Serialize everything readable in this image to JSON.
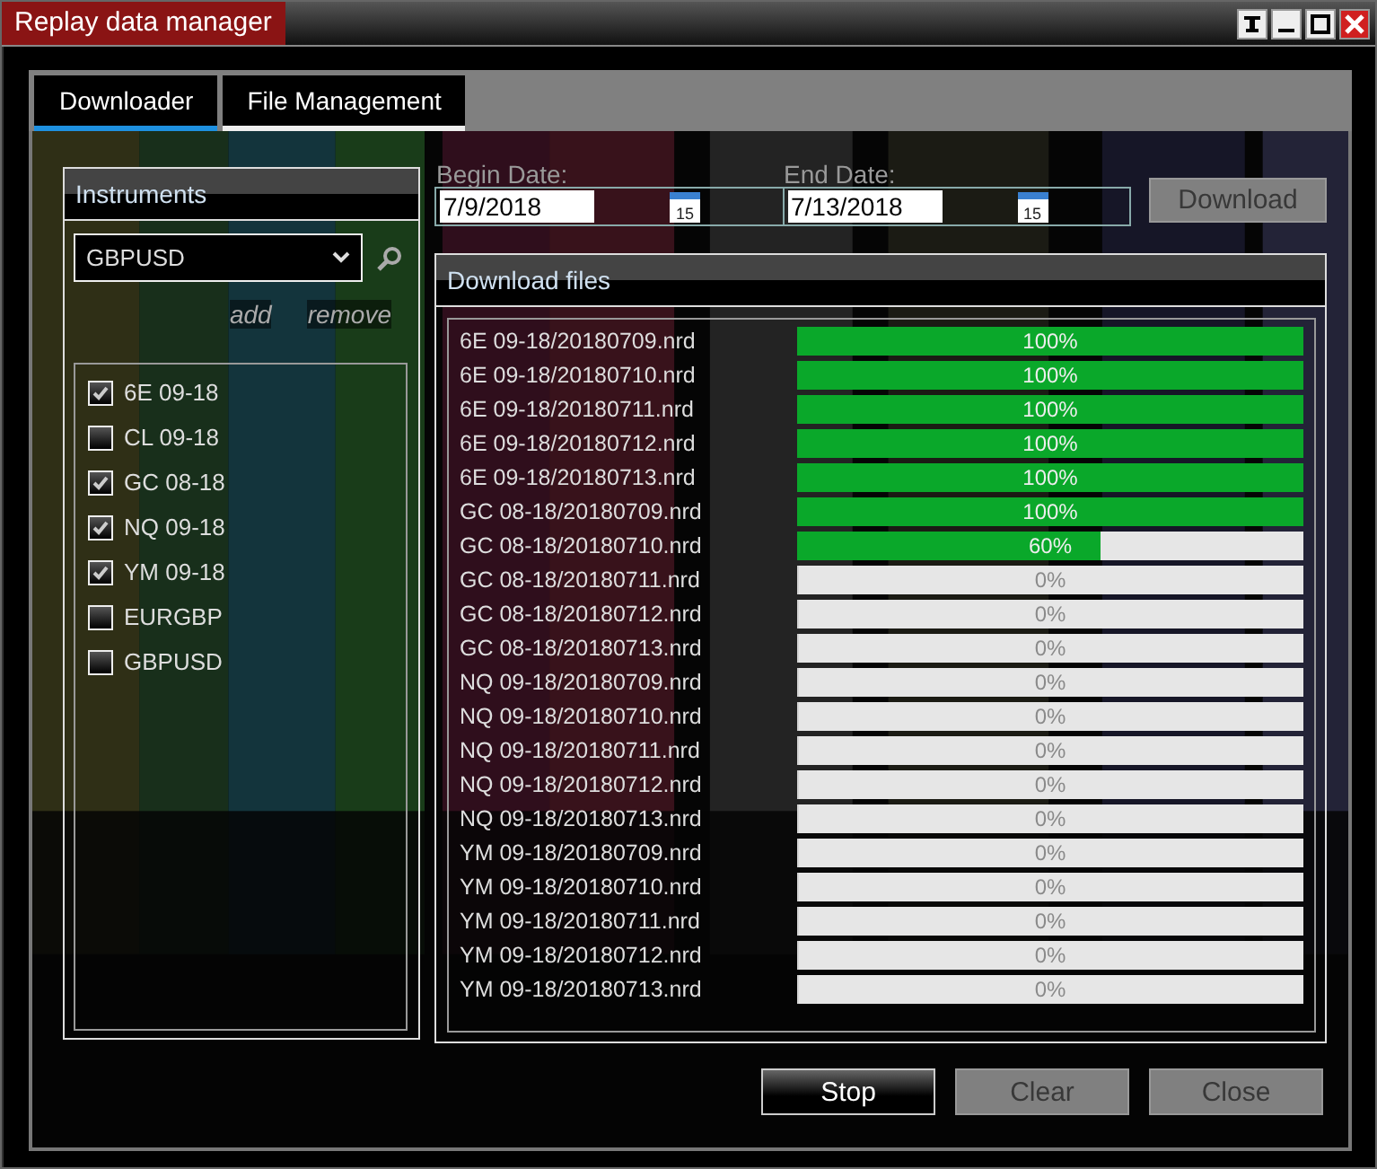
{
  "window": {
    "title": "Replay data manager"
  },
  "tabs": [
    {
      "label": "Downloader",
      "selected": true
    },
    {
      "label": "File Management",
      "selected": false
    }
  ],
  "instruments": {
    "title": "Instruments",
    "dropdown": {
      "value": "GBPUSD"
    },
    "actions": [
      "add",
      "remove"
    ],
    "items": [
      {
        "label": "6E 09-18",
        "checked": true
      },
      {
        "label": "CL 09-18",
        "checked": false
      },
      {
        "label": "GC 08-18",
        "checked": true
      },
      {
        "label": "NQ 09-18",
        "checked": true
      },
      {
        "label": "YM 09-18",
        "checked": true
      },
      {
        "label": "EURGBP",
        "checked": false
      },
      {
        "label": "GBPUSD",
        "checked": false
      }
    ]
  },
  "dates": [
    {
      "label": "Begin Date:",
      "value": "7/9/2018",
      "calendar_day": "15"
    },
    {
      "label": "End Date:",
      "value": "7/13/2018",
      "calendar_day": "15"
    }
  ],
  "download_button": {
    "label": "Download",
    "disabled": true
  },
  "download_files": {
    "title": "Download files",
    "rows": [
      {
        "name": "6E 09-18/20180709.nrd",
        "level": 1,
        "reading": "100%"
      },
      {
        "name": "6E 09-18/20180710.nrd",
        "level": 1,
        "reading": "100%"
      },
      {
        "name": "6E 09-18/20180711.nrd",
        "level": 1,
        "reading": "100%"
      },
      {
        "name": "6E 09-18/20180712.nrd",
        "level": 1,
        "reading": "100%"
      },
      {
        "name": "6E 09-18/20180713.nrd",
        "level": 1,
        "reading": "100%"
      },
      {
        "name": "GC 08-18/20180709.nrd",
        "level": 1,
        "reading": "100%"
      },
      {
        "name": "GC 08-18/20180710.nrd",
        "level": 0.6,
        "reading": "60%"
      },
      {
        "name": "GC 08-18/20180711.nrd",
        "level": 0,
        "reading": "0%"
      },
      {
        "name": "GC 08-18/20180712.nrd",
        "level": 0,
        "reading": "0%"
      },
      {
        "name": "GC 08-18/20180713.nrd",
        "level": 0,
        "reading": "0%"
      },
      {
        "name": "NQ 09-18/20180709.nrd",
        "level": 0,
        "reading": "0%"
      },
      {
        "name": "NQ 09-18/20180710.nrd",
        "level": 0,
        "reading": "0%"
      },
      {
        "name": "NQ 09-18/20180711.nrd",
        "level": 0,
        "reading": "0%"
      },
      {
        "name": "NQ 09-18/20180712.nrd",
        "level": 0,
        "reading": "0%"
      },
      {
        "name": "NQ 09-18/20180713.nrd",
        "level": 0,
        "reading": "0%"
      },
      {
        "name": "YM 09-18/20180709.nrd",
        "level": 0,
        "reading": "0%"
      },
      {
        "name": "YM 09-18/20180710.nrd",
        "level": 0,
        "reading": "0%"
      },
      {
        "name": "YM 09-18/20180711.nrd",
        "level": 0,
        "reading": "0%"
      },
      {
        "name": "YM 09-18/20180712.nrd",
        "level": 0,
        "reading": "0%"
      },
      {
        "name": "YM 09-18/20180713.nrd",
        "level": 0,
        "reading": "0%"
      }
    ]
  },
  "buttons": [
    {
      "label": "Stop",
      "disabled": false
    },
    {
      "label": "Clear",
      "disabled": true
    },
    {
      "label": "Close",
      "disabled": true
    }
  ]
}
